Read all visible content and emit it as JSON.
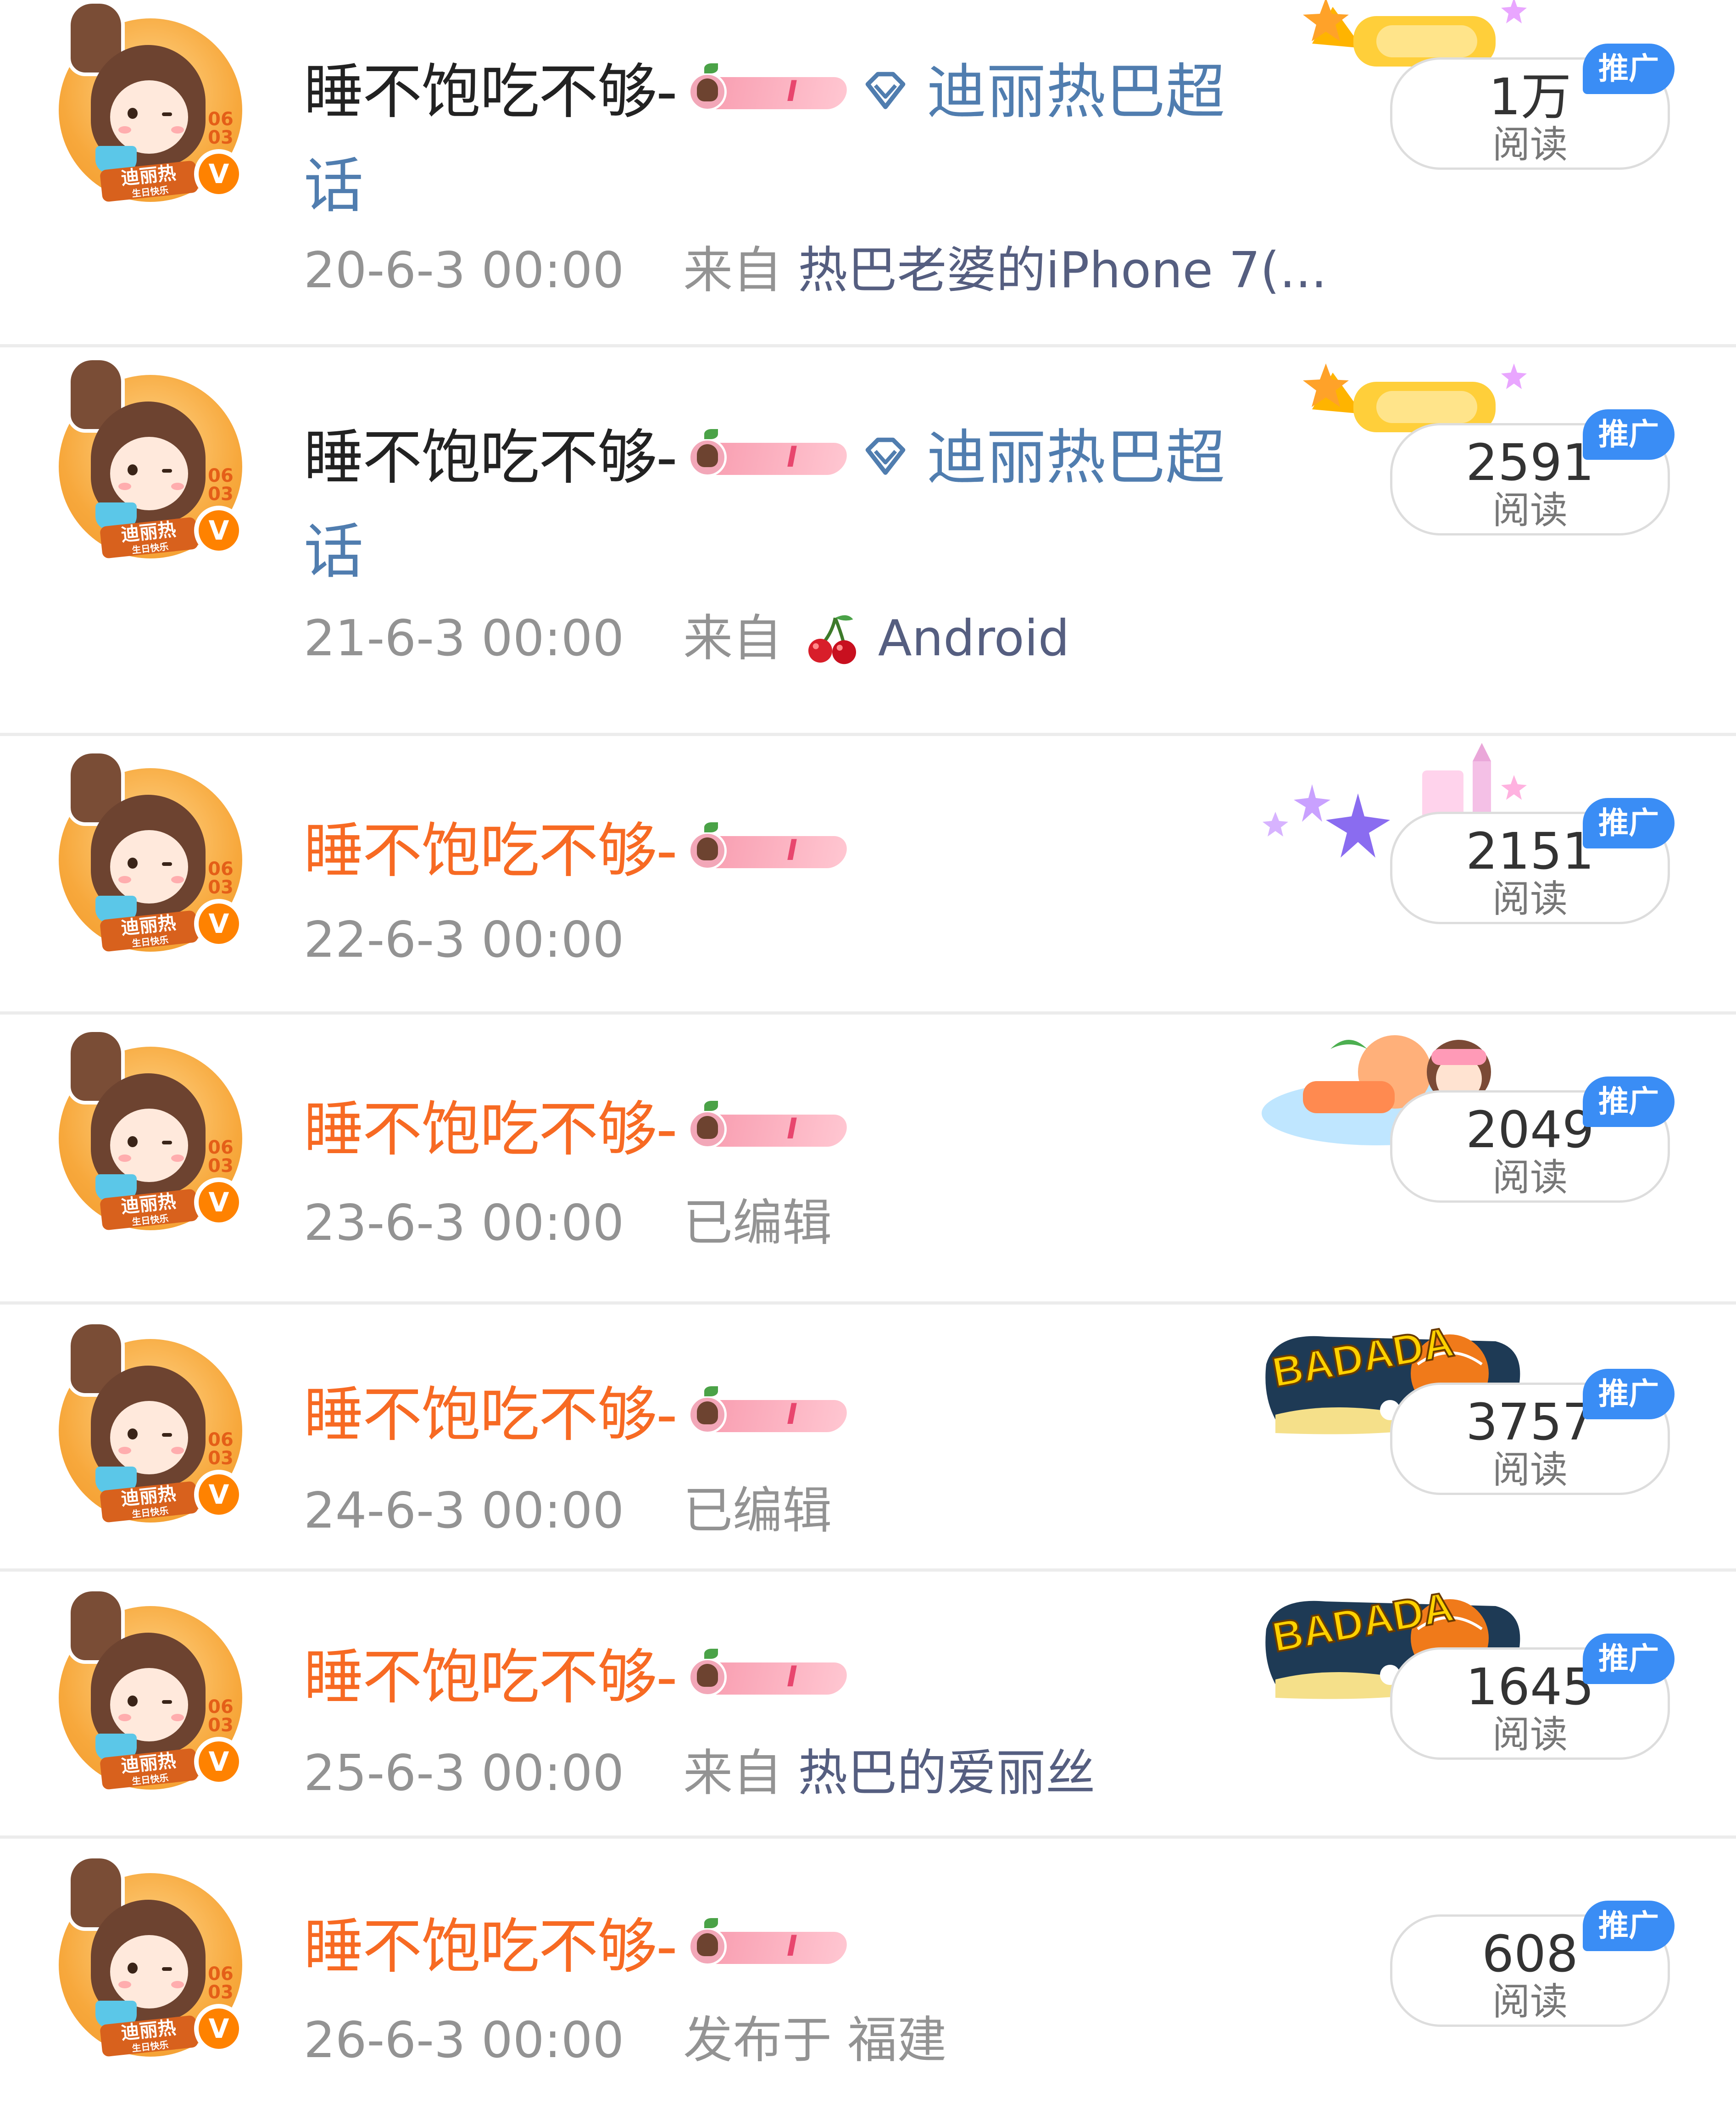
{
  "posts": [
    {
      "name": "睡不饱吃不够-",
      "name_color": "#222222",
      "member_level": "I",
      "topic": "迪丽热巴超话",
      "topic_color": "#507daf",
      "time": "20-6-3 00:00",
      "source_prefix": "来自",
      "source": "热巴老婆的iPhone 7(...",
      "reads": "1万",
      "reads_label": "阅读",
      "promo": "推广",
      "decoration": "stars-banner"
    },
    {
      "name": "睡不饱吃不够-",
      "name_color": "#222222",
      "member_level": "I",
      "topic": "迪丽热巴超话",
      "topic_color": "#507daf",
      "time": "21-6-3 00:00",
      "source_prefix": "来自",
      "source": "Android",
      "source_icon": "cherry-icon",
      "reads": "2591",
      "reads_label": "阅读",
      "promo": "推广",
      "decoration": "stars-banner"
    },
    {
      "name": "睡不饱吃不够-",
      "name_color": "#f76a23",
      "member_level": "I",
      "time": "22-6-3 00:00",
      "reads": "2151",
      "reads_label": "阅读",
      "promo": "推广",
      "decoration": "sparkle-castle"
    },
    {
      "name": "睡不饱吃不够-",
      "name_color": "#f76a23",
      "member_level": "I",
      "time": "23-6-3 00:00",
      "note": "已编辑",
      "reads": "2049",
      "reads_label": "阅读",
      "promo": "推广",
      "decoration": "island-girl"
    },
    {
      "name": "睡不饱吃不够-",
      "name_color": "#f76a23",
      "member_level": "I",
      "time": "24-6-3 00:00",
      "note": "已编辑",
      "reads": "3757",
      "reads_label": "阅读",
      "promo": "推广",
      "decoration": "badada-banner"
    },
    {
      "name": "睡不饱吃不够-",
      "name_color": "#f76a23",
      "member_level": "I",
      "time": "25-6-3 00:00",
      "source_prefix": "来自",
      "source": "热巴的爱丽丝",
      "reads": "1645",
      "reads_label": "阅读",
      "promo": "推广",
      "decoration": "badada-banner"
    },
    {
      "name": "睡不饱吃不够-",
      "name_color": "#f76a23",
      "member_level": "I",
      "time": "26-6-3 00:00",
      "location_prefix": "发布于",
      "location": "福建",
      "reads": "608",
      "reads_label": "阅读",
      "promo": "推广",
      "decoration": "none"
    }
  ],
  "avatar": {
    "badge_numbers": "06 03",
    "stamp_text": "迪丽热",
    "stamp_subtext": "生日快乐",
    "verified_mark": "V",
    "verified_color": "#ff8200"
  },
  "banner_text": "BADADA",
  "colors": {
    "promo_badge": "#3a8df5",
    "source_link": "#555e80",
    "timestamp": "#939393"
  }
}
